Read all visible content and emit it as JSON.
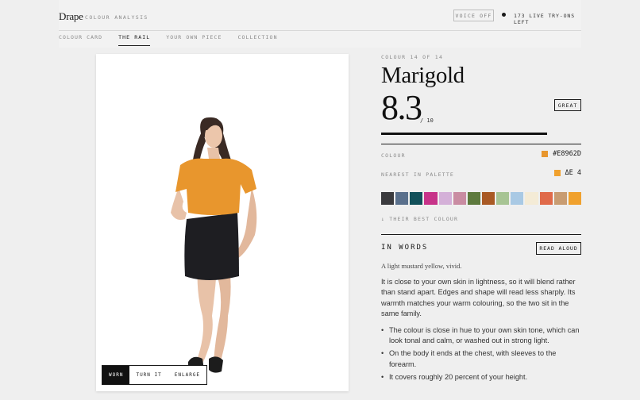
{
  "header": {
    "brand": "Drape",
    "subtitle": "COLOUR ANALYSIS",
    "voice_button": "VOICE OFF",
    "tryons": "173 LIVE TRY-ONS LEFT"
  },
  "tabs": [
    {
      "label": "COLOUR CARD",
      "active": false
    },
    {
      "label": "THE RAIL",
      "active": true
    },
    {
      "label": "YOUR OWN PIECE",
      "active": false
    },
    {
      "label": "COLLECTION",
      "active": false
    }
  ],
  "photo": {
    "buttons": [
      "WORN",
      "TURN IT",
      "ENLARGE"
    ],
    "active_button": "WORN",
    "garment_colour": "#E8962D"
  },
  "detail": {
    "eyebrow": "COLOUR 14 OF 14",
    "name": "Marigold",
    "score": "8.3",
    "score_out_of": "/ 10",
    "score_fraction": 0.83,
    "rating_badge": "GREAT",
    "colour_label": "COLOUR",
    "colour_value": "#E8962D",
    "colour_hex": "#E8962D",
    "nearest_label": "NEAREST IN PALETTE",
    "nearest_value": "ΔE 4",
    "nearest_hex": "#F0A12E",
    "palette": [
      "#3b3b3e",
      "#5a708c",
      "#12505a",
      "#c73389",
      "#d4b0d8",
      "#c98ca2",
      "#5e7a3e",
      "#a95a25",
      "#a7c494",
      "#a9c9e4",
      "#f4ebd6",
      "#e06a4a",
      "#c89c72",
      "#f0a12e"
    ],
    "best_colour_label": "↓ THEIR BEST COLOUR",
    "words_title": "IN WORDS",
    "read_aloud": "READ ALOUD",
    "tagline": "A light mustard yellow, vivid.",
    "paragraph": "It is close to your own skin in lightness, so it will blend rather than stand apart. Edges and shape will read less sharply. Its warmth matches your warm colouring, so the two sit in the same family.",
    "bullets": [
      "The colour is close in hue to your own skin tone, which can look tonal and calm, or washed out in strong light.",
      "On the body it ends at the chest, with sleeves to the forearm.",
      "It covers roughly 20 percent of your height."
    ]
  }
}
